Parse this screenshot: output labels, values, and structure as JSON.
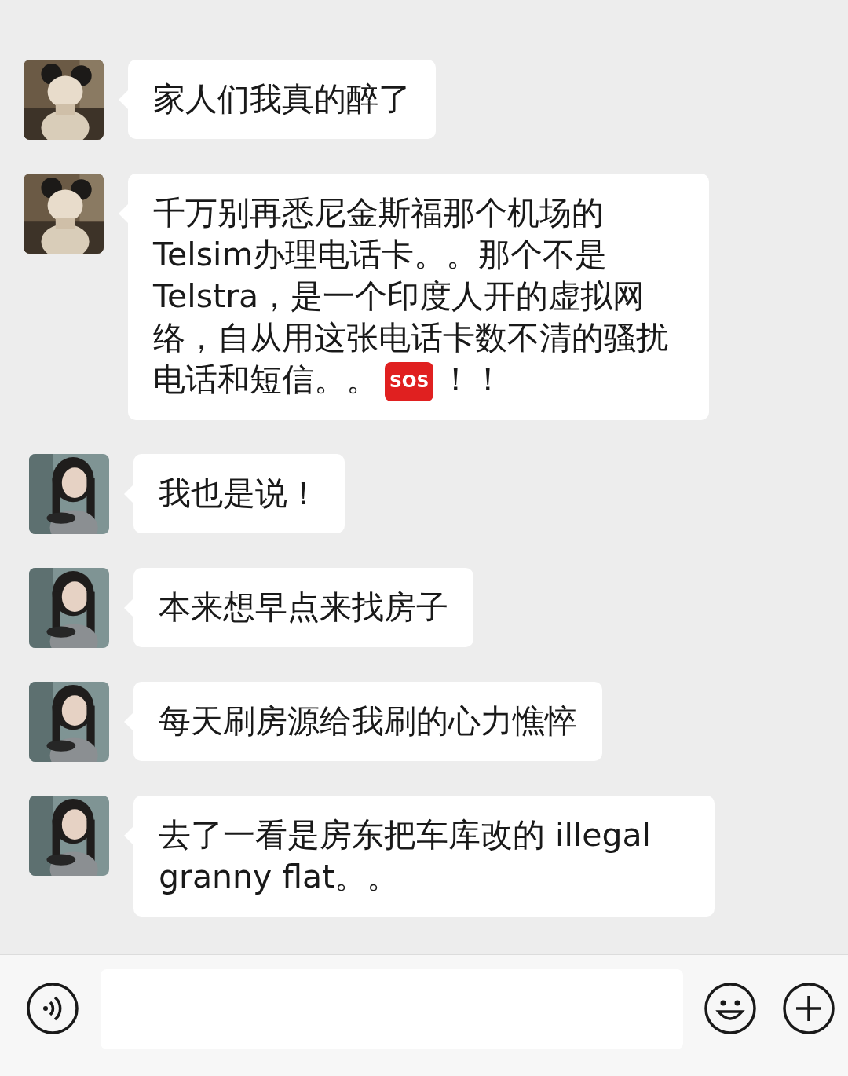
{
  "messages": [
    {
      "kind": "mouse",
      "lines": [
        [
          {
            "kind": "text",
            "text": "家人们我真的醉了"
          }
        ]
      ]
    },
    {
      "kind": "mouse",
      "lines": [
        [
          {
            "kind": "text",
            "text": "千万别再悉尼金斯福那个机场的Telsim办理电话卡。。那个不是Telstra，是一个印度人开的虚拟网络，自从用这张电话卡数不清的骚扰"
          }
        ],
        [
          {
            "kind": "text",
            "text": "电话和短信。。"
          },
          {
            "kind": "badge",
            "text": "SOS"
          },
          {
            "kind": "text",
            "text": "！！"
          }
        ]
      ]
    },
    {
      "kind": "figure",
      "lines": [
        [
          {
            "kind": "text",
            "text": "我也是说！"
          }
        ]
      ]
    },
    {
      "kind": "figure",
      "lines": [
        [
          {
            "kind": "text",
            "text": "本来想早点来找房子"
          }
        ]
      ]
    },
    {
      "kind": "figure",
      "lines": [
        [
          {
            "kind": "text",
            "text": "每天刷房源给我刷的心力憔悴"
          }
        ]
      ]
    },
    {
      "kind": "figure",
      "lines": [
        [
          {
            "kind": "text",
            "text": "去了一看是房东把车库改的 illegal granny flat。。"
          }
        ]
      ]
    }
  ]
}
